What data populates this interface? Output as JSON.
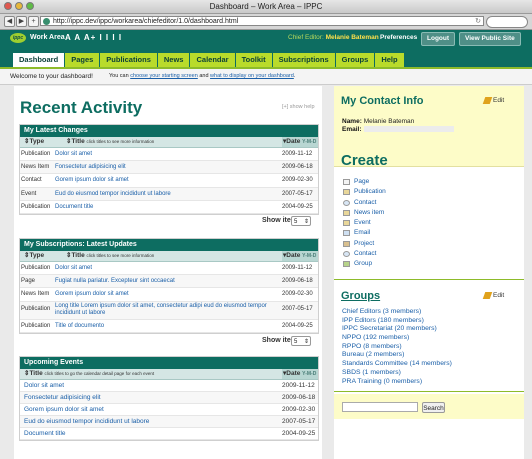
{
  "window": {
    "title": "Dashboard – Work Area – IPPC"
  },
  "browser": {
    "url": "http://ippc.dev/ippc/workarea/chiefeditor/1.0/dashboard.html",
    "back": "◀",
    "forward": "▶",
    "add": "+"
  },
  "header": {
    "logo_text": "ippc",
    "work_area": "Work Area",
    "font_sizes": "A A A+ I I I I",
    "role_label": "Chief Editor:",
    "user_name": "Melanie Bateman",
    "preferences": "Preferences",
    "logout": "Logout",
    "view_public": "View Public Site"
  },
  "tabs": [
    "Dashboard",
    "Pages",
    "Publications",
    "News",
    "Calendar",
    "Toolkit",
    "Subscriptions",
    "Groups",
    "Help"
  ],
  "welcome": {
    "text": "Welcome to your dashboard!",
    "prefix": "You can",
    "link1": "choose your starting screen",
    "mid": "and",
    "link2": "what to display on your dashboard",
    "suffix": "."
  },
  "recent": {
    "title": "Recent Activity",
    "show_help": "[+] show help"
  },
  "latest_changes": {
    "title": "My Latest Changes",
    "col_type": "Type",
    "col_title": "Title",
    "col_title_hint": "click titles to see more information",
    "col_date": "Date",
    "col_date_hint": "Y-M-D",
    "rows": [
      {
        "type": "Publication",
        "title": "Dolor sit amet",
        "date": "2009-11-12"
      },
      {
        "type": "News Item",
        "title": "Fonsectetur adipisicing elit",
        "date": "2009-06-18"
      },
      {
        "type": "Contact",
        "title": "Gorem ipsum dolor sit amet",
        "date": "2009-02-30"
      },
      {
        "type": "Event",
        "title": "Eud do eiusmod tempor incididunt ut labore",
        "date": "2007-05-17"
      },
      {
        "type": "Publication",
        "title": "Document title",
        "date": "2004-09-25"
      }
    ],
    "show_items": "Show items:",
    "count": "5"
  },
  "subscriptions": {
    "title": "My Subscriptions: Latest Updates",
    "col_type": "Type",
    "col_title": "Title",
    "col_title_hint": "click titles to see more information",
    "col_date": "Date",
    "col_date_hint": "Y-M-D",
    "rows": [
      {
        "type": "Publication",
        "title": "Dolor sit amet",
        "date": "2009-11-12"
      },
      {
        "type": "Page",
        "title": "Fugiat nulla pariatur. Excepteur sint occaecat",
        "date": "2009-06-18"
      },
      {
        "type": "News Item",
        "title": "Gorem ipsum dolor sit amet",
        "date": "2009-02-30"
      },
      {
        "type": "Publication",
        "title": "Long title Lorem ipsum dolor sit amet, consectetur adipi eud do eiusmod tempor incididunt ut labore",
        "date": "2007-05-17"
      },
      {
        "type": "Publication",
        "title": "Title of documento",
        "date": "2004-09-25"
      }
    ],
    "show_items": "Show items:",
    "count": "5"
  },
  "events": {
    "title": "Upcoming Events",
    "col_title": "Title",
    "col_title_hint": "click titles to go the calendar detail page for each event",
    "col_date": "Date",
    "col_date_hint": "Y-M-D",
    "rows": [
      {
        "title": "Dolor sit amet",
        "date": "2009-11-12"
      },
      {
        "title": "Fonsectetur adipisicing elit",
        "date": "2009-06-18"
      },
      {
        "title": "Gorem ipsum dolor sit amet",
        "date": "2009-02-30"
      },
      {
        "title": "Eud do eiusmod tempor incididunt ut labore",
        "date": "2007-05-17"
      },
      {
        "title": "Document title",
        "date": "2004-09-25"
      }
    ]
  },
  "contact": {
    "title": "My Contact Info",
    "edit": "Edit",
    "name_label": "Name:",
    "name_value": "Melanie Bateman",
    "email_label": "Email:"
  },
  "create": {
    "title": "Create",
    "items": [
      "Page",
      "Publication",
      "Contact",
      "News item",
      "Event",
      "Email",
      "Project",
      "Contact",
      "Group"
    ]
  },
  "groups": {
    "title": "Groups",
    "edit": "Edit",
    "items": [
      "Chief Editors (3 members)",
      "IPP Editors (180 members)",
      "IPPC Secretariat (20 members)",
      "NPPO (192 members)",
      "RPPO (8 members)",
      "Bureau (2 members)",
      "Standards Committee (14 members)",
      "SBDS (1 members)",
      "PRA Training (0 members)"
    ]
  },
  "search": {
    "button": "Search",
    "value": ""
  },
  "colors": {
    "brand": "#0d6d61",
    "accent": "#b9db2b",
    "link": "#1a5fa8",
    "highlight": "#fdfcc8"
  }
}
